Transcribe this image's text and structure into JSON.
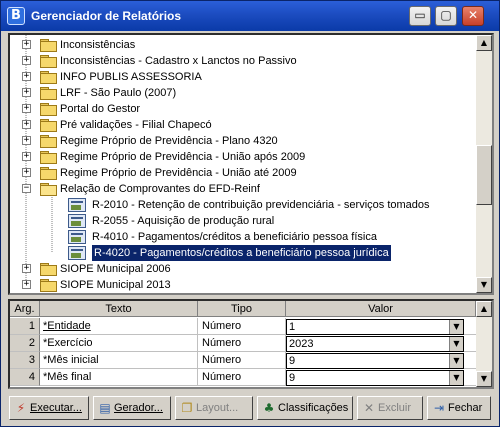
{
  "window": {
    "title": "Gerenciador de Relatórios",
    "app_icon": "B",
    "controls": {
      "minimize": "▭",
      "maximize": "▢",
      "close": "✕"
    }
  },
  "tree": {
    "items": [
      {
        "label": "Inconsistências",
        "type": "folder",
        "expander": "+"
      },
      {
        "label": "Inconsistências - Cadastro x Lanctos no Passivo",
        "type": "folder",
        "expander": "+"
      },
      {
        "label": "INFO PUBLIS ASSESSORIA",
        "type": "folder",
        "expander": "+"
      },
      {
        "label": "LRF - São Paulo (2007)",
        "type": "folder",
        "expander": "+"
      },
      {
        "label": "Portal do Gestor",
        "type": "folder",
        "expander": "+"
      },
      {
        "label": "Pré validações - Filial Chapecó",
        "type": "folder",
        "expander": "+"
      },
      {
        "label": "Regime Próprio de Previdência - Plano 4320",
        "type": "folder",
        "expander": "+"
      },
      {
        "label": "Regime Próprio de Previdência - União após 2009",
        "type": "folder",
        "expander": "+"
      },
      {
        "label": "Regime Próprio de Previdência - União até 2009",
        "type": "folder",
        "expander": "+"
      },
      {
        "label": "Relação de Comprovantes do EFD-Reinf",
        "type": "folder-open",
        "expander": "−"
      },
      {
        "label": "R-2010 - Retenção de contribuição previdenciária - serviços tomados",
        "type": "report"
      },
      {
        "label": "R-2055 - Aquisição de produção rural",
        "type": "report"
      },
      {
        "label": "R-4010 - Pagamentos/créditos a beneficiário pessoa física",
        "type": "report"
      },
      {
        "label": "R-4020 - Pagamentos/créditos a beneficiário pessoa jurídica",
        "type": "report",
        "selected": true
      },
      {
        "label": "SIOPE Municipal 2006",
        "type": "folder",
        "expander": "+"
      },
      {
        "label": "SIOPE Municipal 2013",
        "type": "folder",
        "expander": "+"
      }
    ]
  },
  "args": {
    "headers": {
      "arg": "Arg.",
      "texto": "Texto",
      "tipo": "Tipo",
      "valor": "Valor"
    },
    "rows": [
      {
        "num": "1",
        "texto": "*Entidade",
        "tipo": "Número",
        "valor": "1"
      },
      {
        "num": "2",
        "texto": "*Exercício",
        "tipo": "Número",
        "valor": "2023"
      },
      {
        "num": "3",
        "texto": "*Mês inicial",
        "tipo": "Número",
        "valor": "9"
      },
      {
        "num": "4",
        "texto": "*Mês final",
        "tipo": "Número",
        "valor": "9"
      }
    ]
  },
  "toolbar": {
    "executar": "Executar...",
    "gerador": "Gerador...",
    "layout": "Layout...",
    "classificacoes": "Classificações",
    "excluir": "Excluir",
    "fechar": "Fechar"
  }
}
